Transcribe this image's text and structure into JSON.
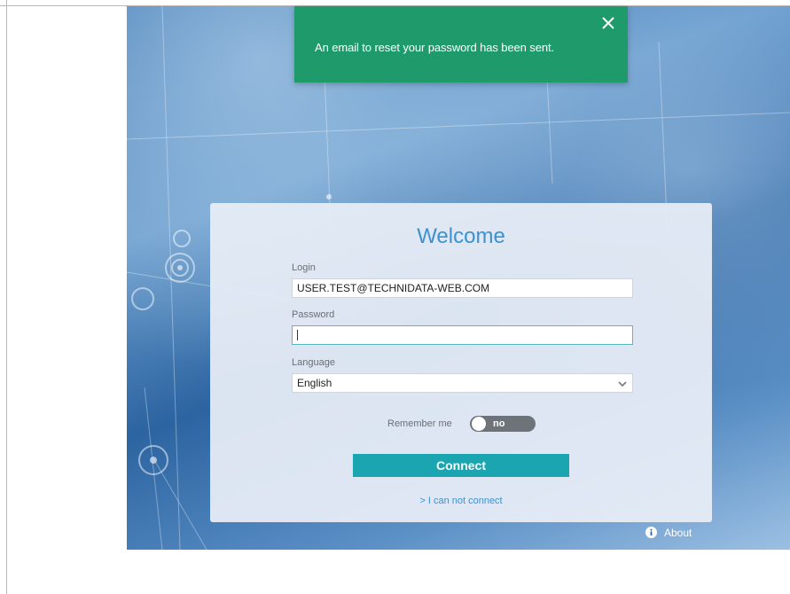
{
  "notification": {
    "message": "An email to reset your password has been sent.",
    "close_icon": "close-icon",
    "color": "#1f9a6b"
  },
  "login_form": {
    "title": "Welcome",
    "login": {
      "label": "Login",
      "value": "USER.TEST@TECHNIDATA-WEB.COM"
    },
    "password": {
      "label": "Password",
      "value": ""
    },
    "language": {
      "label": "Language",
      "selected": "English",
      "chevron_icon": "chevron-down-icon"
    },
    "remember_me": {
      "label": "Remember me",
      "state": "no"
    },
    "connect_label": "Connect",
    "cant_connect_label": "> I can not connect",
    "accent_color": "#1aa5b1",
    "title_color": "#3c92cf"
  },
  "footer": {
    "about_label": "About",
    "about_icon": "info-icon"
  }
}
